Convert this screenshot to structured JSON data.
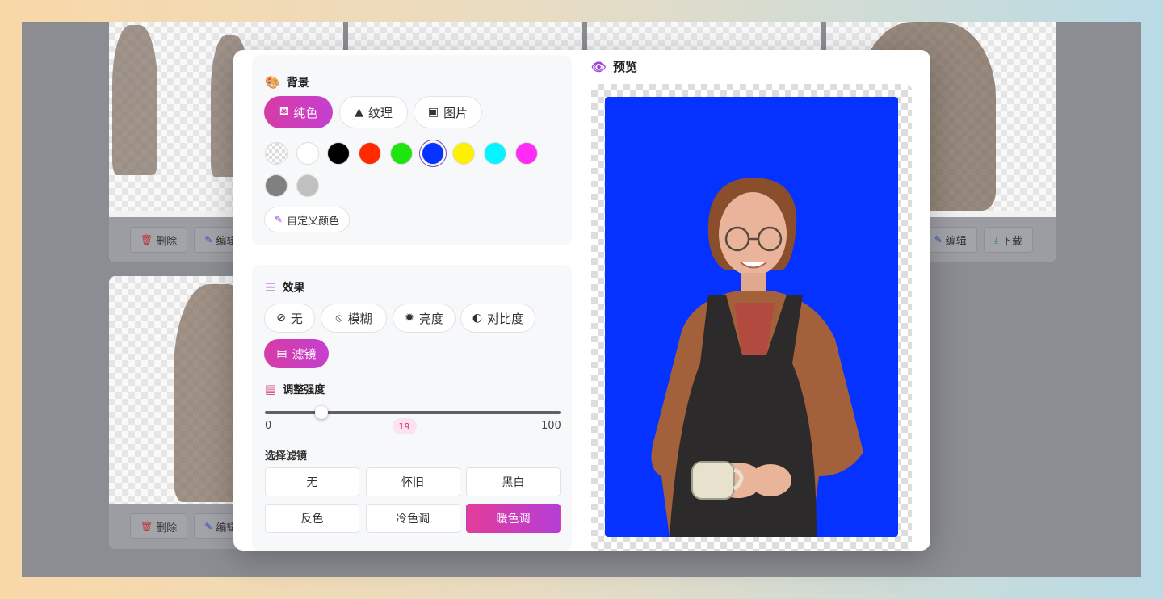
{
  "background_cards": {
    "delete_label": "删除",
    "edit_label": "编辑",
    "download_label": "下载"
  },
  "background_section": {
    "title": "背景",
    "tabs": [
      {
        "label": "纯色",
        "active": true
      },
      {
        "label": "纹理",
        "active": false
      },
      {
        "label": "图片",
        "active": false
      }
    ],
    "swatches": [
      {
        "name": "transparent",
        "color": "checker"
      },
      {
        "name": "white",
        "color": "#ffffff"
      },
      {
        "name": "black",
        "color": "#000000"
      },
      {
        "name": "red",
        "color": "#ff2a00"
      },
      {
        "name": "green",
        "color": "#1ee50f"
      },
      {
        "name": "blue",
        "color": "#0632ff",
        "selected": true
      },
      {
        "name": "yellow",
        "color": "#ffef00"
      },
      {
        "name": "cyan",
        "color": "#05f4ff"
      },
      {
        "name": "magenta",
        "color": "#ff2cf5"
      },
      {
        "name": "gray",
        "color": "#808080"
      },
      {
        "name": "silver",
        "color": "#c0c0c0"
      }
    ],
    "custom_color_label": "自定义颜色"
  },
  "effects_section": {
    "title": "效果",
    "options": [
      {
        "label": "无",
        "icon": "ban-icon",
        "active": false
      },
      {
        "label": "模糊",
        "icon": "blur-drop-icon",
        "active": false
      },
      {
        "label": "亮度",
        "icon": "sun-icon",
        "active": false
      },
      {
        "label": "对比度",
        "icon": "contrast-icon",
        "active": false
      },
      {
        "label": "滤镜",
        "icon": "images-icon",
        "active": true
      }
    ],
    "intensity_label": "调整强度",
    "slider": {
      "min": "0",
      "max": "100",
      "value": "19",
      "fraction": 0.19
    },
    "filter_select_label": "选择滤镜",
    "filters": [
      {
        "label": "无",
        "active": false
      },
      {
        "label": "怀旧",
        "active": false
      },
      {
        "label": "黑白",
        "active": false
      },
      {
        "label": "反色",
        "active": false
      },
      {
        "label": "冷色调",
        "active": false
      },
      {
        "label": "暖色调",
        "active": true
      }
    ]
  },
  "preview": {
    "title": "预览",
    "background_color": "#0632ff"
  }
}
